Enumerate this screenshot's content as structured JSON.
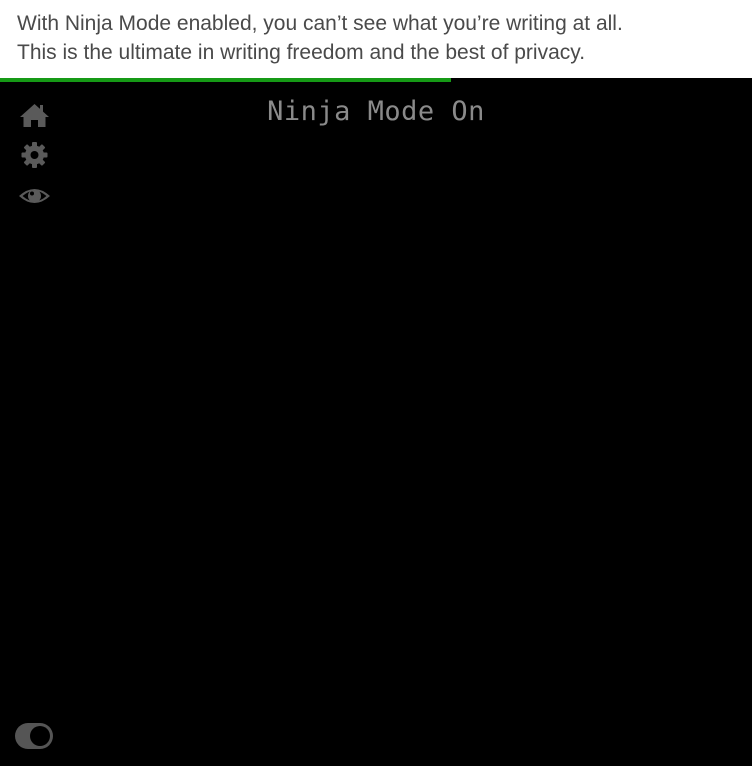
{
  "banner": {
    "line1": "With Ninja Mode enabled, you can’t see what you’re writing at all.",
    "line2": "This is the ultimate in writing freedom and the best of privacy."
  },
  "progress": {
    "value": 0.6,
    "color": "#169a16"
  },
  "sidebar": {
    "icons": [
      "home-icon",
      "gear-icon",
      "eye-icon"
    ],
    "icon_color": "#5a5a5a"
  },
  "editor": {
    "title": "Ninja Mode On"
  },
  "toggle": {
    "state": "on"
  },
  "colors": {
    "background": "#000000",
    "banner_text": "#4a4a4a",
    "title_text": "#8a8a8a"
  }
}
